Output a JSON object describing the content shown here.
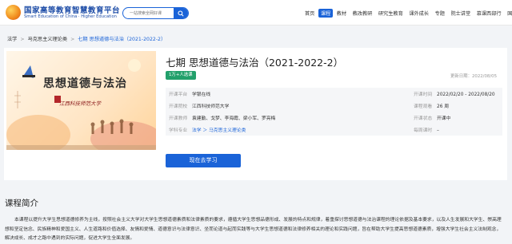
{
  "header": {
    "logo_title": "国家高等教育智慧教育平台",
    "logo_subtitle": "Smart Education of China · Higher Education",
    "search_placeholder": "一站搜索全网好课",
    "nav": [
      "首页",
      "课程",
      "教材",
      "教改教研",
      "研究生教育",
      "课外成长",
      "专题",
      "院士讲堂",
      "慕课西部行",
      "国际平台"
    ],
    "active_nav_index": 1
  },
  "breadcrumb": [
    "法学",
    "马克思主义理论类",
    "七期 思想道德与法治（2021-2022-2）"
  ],
  "cover": {
    "title": "思想道德与法治",
    "school_logo_text": "江西科技师范大学"
  },
  "course": {
    "title": "七期 思想道德与法治（2021-2022-2）",
    "participants": "1万+人选课",
    "updated": "更新日期：2022/08/05"
  },
  "info": {
    "platform_label": "开课平台",
    "platform_value": "学银在线",
    "time_label": "开课时间",
    "time_value": "2022/02/20 - 2022/08/20",
    "school_label": "开课院校",
    "school_value": "江西科技师范大学",
    "hours_label": "课程观看",
    "hours_value": "26 周",
    "teachers_label": "开课教师",
    "teachers_value": "袁建勤、戈梦、李海霞、梁小军、罗亮梅",
    "status_label": "开课状态",
    "status_value": "开课中",
    "major_label": "学科专业",
    "major_value": "法学 ＞ 马克思主义理论类",
    "credit_label": "每周课时",
    "credit_value": "–"
  },
  "study_button": "现在去学习",
  "intro": {
    "title": "课程简介",
    "text": "本课程以提升大学生思想道德修养为主线，按照社会主义大学对大学生思想道德素质和法律素质的要求，遵循大学生思想品德形成、发展的特点和规律，着重探讨思想道德与法治课程的理论依据及基本要求，以及人生发展和大学生、崇高理想和坚定信念、民族精神和爱国主义、人生道路和价值选择、友情和爱情、道德意识与法律意识、坐而论道与起而实践等与大学生思想道德和法律修养相关的理论和实践问题，旨在帮助大学生提高思想道德素质，增强大学生社会主义法制观念，解决成长、成才之路中遇到的实际问题，促进大学生全面发展。"
  },
  "colors": {
    "primary": "#1a63d8",
    "badge": "#22a06b"
  }
}
